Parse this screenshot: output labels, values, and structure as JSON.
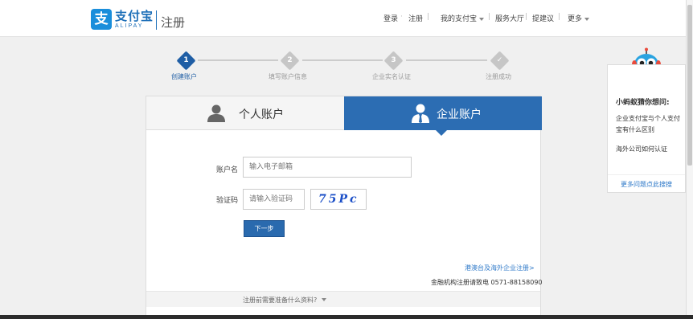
{
  "header": {
    "logo_mark": "支",
    "logo_cn": "支付宝",
    "logo_en": "ALIPAY",
    "page_label": "注册",
    "nav": {
      "login": "登录",
      "register": "注册",
      "my_alipay": "我的支付宝",
      "service_hall": "服务大厅",
      "feedback": "提建议",
      "more": "更多"
    }
  },
  "steps": [
    {
      "number": "1",
      "label": "创建账户",
      "state": "active"
    },
    {
      "number": "2",
      "label": "填写账户信息",
      "state": "pending"
    },
    {
      "number": "3",
      "label": "企业实名认证",
      "state": "pending"
    },
    {
      "number": "",
      "label": "注册成功",
      "state": "pending"
    }
  ],
  "tabs": {
    "personal": "个人账户",
    "enterprise": "企业账户"
  },
  "form": {
    "account_label": "账户名",
    "account_placeholder": "输入电子邮箱",
    "captcha_label": "验证码",
    "captcha_placeholder": "请输入验证码",
    "captcha_text": "75Pc",
    "next_button": "下一步"
  },
  "links": {
    "overseas_register": "港澳台及海外企业注册>",
    "hotline": "金融机构注册请致电 0571-88158090",
    "prepare_materials": "注册前需要准备什么资料?"
  },
  "help_panel": {
    "title": "小蚂蚁猜你想问:",
    "items": [
      "企业支付宝与个人支付宝有什么区别",
      "海外公司如何认证"
    ],
    "more": "更多问题点此搜搜"
  },
  "colors": {
    "brand_blue": "#1d6fb8",
    "tab_active": "#2c6db3",
    "link": "#2d78c8"
  },
  "icons": [
    "user-icon",
    "business-user-icon",
    "check-icon",
    "chevron-down-icon",
    "mascot-icon"
  ]
}
